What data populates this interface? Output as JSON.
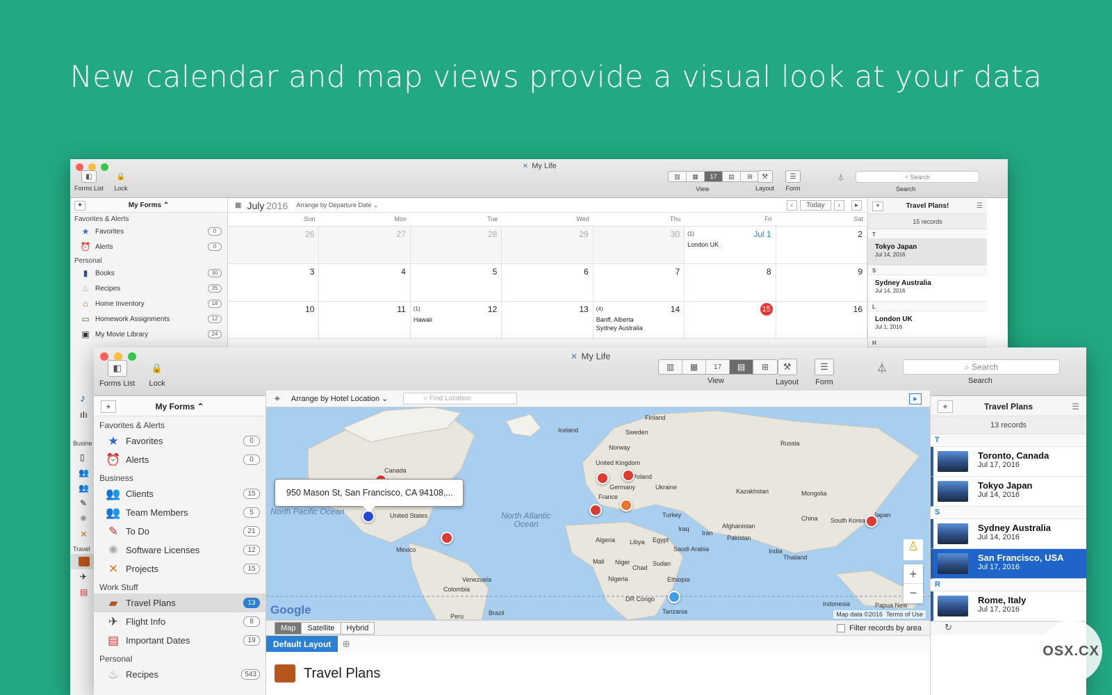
{
  "headline": "New calendar and map views provide a visual look at your data",
  "back": {
    "title": "My Life",
    "toolbar": {
      "forms_list": "Forms List",
      "lock": "Lock",
      "view": "View",
      "layout": "Layout",
      "form": "Form",
      "search": "Search",
      "search_placeholder": "Search"
    },
    "forms_header": "My Forms ⌃",
    "sections": [
      {
        "name": "Favorites & Alerts",
        "items": [
          {
            "label": "Favorites",
            "count": "0",
            "icon": "star-icon"
          },
          {
            "label": "Alerts",
            "count": "0",
            "icon": "alarm-clock-icon"
          }
        ]
      },
      {
        "name": "Personal",
        "items": [
          {
            "label": "Books",
            "count": "30",
            "icon": "book-icon"
          },
          {
            "label": "Recipes",
            "count": "35",
            "icon": "chef-hat-icon"
          },
          {
            "label": "Home Inventory",
            "count": "18",
            "icon": "house-icon"
          },
          {
            "label": "Homework Assignments",
            "count": "12",
            "icon": "chalkboard-icon"
          },
          {
            "label": "My Movie Library",
            "count": "24",
            "icon": "clapperboard-icon"
          }
        ]
      }
    ],
    "calendar": {
      "month": "July",
      "year": "2016",
      "arrange": "Arrange by Departure Date ⌄",
      "today": "Today",
      "days": [
        "Sun",
        "Mon",
        "Tue",
        "Wed",
        "Thu",
        "Fri",
        "Sat"
      ],
      "weeks": [
        [
          {
            "d": "26",
            "gray": true
          },
          {
            "d": "27",
            "gray": true
          },
          {
            "d": "28",
            "gray": true
          },
          {
            "d": "29",
            "gray": true
          },
          {
            "d": "30",
            "gray": true
          },
          {
            "d": "Jul 1",
            "blue": true,
            "count": "(1)",
            "events": [
              "London UK"
            ]
          },
          {
            "d": "2"
          }
        ],
        [
          {
            "d": "3"
          },
          {
            "d": "4"
          },
          {
            "d": "5"
          },
          {
            "d": "6"
          },
          {
            "d": "7"
          },
          {
            "d": "8"
          },
          {
            "d": "9"
          }
        ],
        [
          {
            "d": "10"
          },
          {
            "d": "11"
          },
          {
            "d": "12",
            "count": "(1)",
            "events": [
              "Hawaii"
            ]
          },
          {
            "d": "13"
          },
          {
            "d": "14",
            "count": "(4)",
            "events": [
              "Banff, Alberta",
              "Sydney Australia"
            ]
          },
          {
            "d": "15",
            "today": true
          },
          {
            "d": "16"
          }
        ]
      ]
    },
    "records": {
      "title": "Travel Plans!",
      "count": "15 records",
      "groups": [
        {
          "letter": "T",
          "items": [
            {
              "name": "Tokyo Japan",
              "date": "Jul 14, 2016",
              "selected": true
            }
          ]
        },
        {
          "letter": "S",
          "items": [
            {
              "name": "Sydney Australia",
              "date": "Jul 14, 2016"
            }
          ]
        },
        {
          "letter": "L",
          "items": [
            {
              "name": "London UK",
              "date": "Jul 1, 2016"
            }
          ]
        },
        {
          "letter": "H",
          "items": []
        }
      ]
    },
    "strip_labels": {
      "busine": "Busine",
      "travel": "Travel"
    }
  },
  "front": {
    "title": "My Life",
    "toolbar": {
      "forms_list": "Forms List",
      "lock": "Lock",
      "view": "View",
      "layout": "Layout",
      "form": "Form",
      "search": "Search",
      "search_placeholder": "Search"
    },
    "forms_header": "My Forms ⌃",
    "arrange": "Arrange by Hotel Location ⌄",
    "find_placeholder": "Find Location",
    "sections": [
      {
        "name": "Favorites & Alerts",
        "items": [
          {
            "label": "Favorites",
            "count": "0",
            "icon": "star-icon"
          },
          {
            "label": "Alerts",
            "count": "0",
            "icon": "alarm-clock-icon"
          }
        ]
      },
      {
        "name": "Business",
        "items": [
          {
            "label": "Clients",
            "count": "15",
            "icon": "people-icon"
          },
          {
            "label": "Team Members",
            "count": "5",
            "icon": "people-icon"
          },
          {
            "label": "To Do",
            "count": "21",
            "icon": "checklist-icon"
          },
          {
            "label": "Software Licenses",
            "count": "12",
            "icon": "disc-icon"
          },
          {
            "label": "Projects",
            "count": "15",
            "icon": "tools-icon"
          }
        ]
      },
      {
        "name": "Work Stuff",
        "items": [
          {
            "label": "Travel Plans",
            "count": "13",
            "icon": "suitcase-icon",
            "selected": true
          },
          {
            "label": "Flight Info",
            "count": "8",
            "icon": "airplane-icon"
          },
          {
            "label": "Important Dates",
            "count": "19",
            "icon": "calendar-icon"
          }
        ]
      },
      {
        "name": "Personal",
        "items": [
          {
            "label": "Recipes",
            "count": "543",
            "icon": "chef-hat-icon"
          }
        ]
      }
    ],
    "map": {
      "bubble": "950 Mason St, San Francisco, CA  94108,...",
      "countries": [
        "Canada",
        "United States",
        "Mexico",
        "Venezuela",
        "Colombia",
        "Peru",
        "Brazil",
        "Iceland",
        "Finland",
        "Sweden",
        "Norway",
        "United Kingdom",
        "Germany",
        "Poland",
        "Ukraine",
        "France",
        "Turkey",
        "Russia",
        "Kazakhstan",
        "Mongolia",
        "China",
        "South Korea",
        "Japan",
        "Afghanistan",
        "Pakistan",
        "Iraq",
        "Iran",
        "India",
        "Thailand",
        "Indonesia",
        "Papua New",
        "Saudi Arabia",
        "Egypt",
        "Libya",
        "Algeria",
        "Mali",
        "Niger",
        "Chad",
        "Sudan",
        "Ethiopia",
        "Nigeria",
        "DR Congo",
        "Tanzania"
      ],
      "ocean_north_pacific": "North Pacific Ocean",
      "ocean_north_atlantic": "North Atlantic Ocean",
      "credits": [
        "Map data ©2016",
        "Terms of Use"
      ],
      "logo": "Google",
      "tabs": [
        "Map",
        "Satellite",
        "Hybrid"
      ],
      "filter": "Filter records by area"
    },
    "layout_tab": "Default Layout",
    "form_title": "Travel Plans",
    "records": {
      "title": "Travel Plans",
      "count": "13 records",
      "groups": [
        {
          "letter": "T",
          "items": [
            {
              "name": "Toronto, Canada",
              "date": "Jul 17, 2016"
            },
            {
              "name": "Tokyo Japan",
              "date": "Jul 14, 2016"
            }
          ]
        },
        {
          "letter": "S",
          "items": [
            {
              "name": "Sydney Australia",
              "date": "Jul 14, 2016"
            },
            {
              "name": "San Francisco, USA",
              "date": "Jul 17, 2016",
              "selected": true
            }
          ]
        },
        {
          "letter": "R",
          "items": [
            {
              "name": "Rome, Italy",
              "date": "Jul 17, 2016"
            }
          ]
        }
      ]
    }
  },
  "watermark": "OSX.CX",
  "colors": {
    "background": "#22a883",
    "accent": "#2d7fd3",
    "today": "#e53935",
    "pin_red": "#dc3b33",
    "pin_blue": "#2747d6"
  }
}
